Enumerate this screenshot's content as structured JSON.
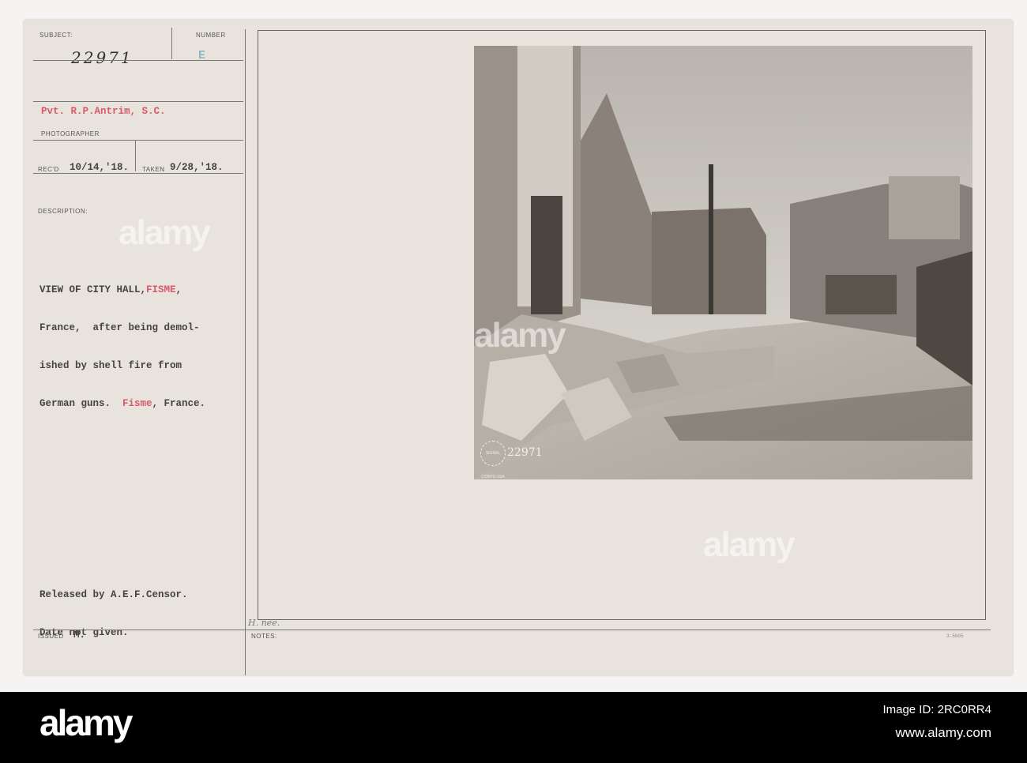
{
  "card": {
    "subject_label": "SUBJECT:",
    "subject_value": "22971",
    "number_label": "NUMBER",
    "number_value": "E",
    "photographer_value": "Pvt. R.P.Antrim, S.C.",
    "photographer_label": "PHOTOGRAPHER",
    "recd_label": "REC'D",
    "recd_value": "10/14,'18.",
    "taken_label": "TAKEN",
    "taken_value": "9/28,'18.",
    "description_label": "DESCRIPTION:",
    "description": {
      "line1_a": "VIEW OF CITY HALL,",
      "line1_red": "FISME",
      "line1_b": ",",
      "line2": "France,  after being demol-",
      "line3": "ished by shell fire from",
      "line4_a": "German guns.  ",
      "line4_red": "Fisme",
      "line4_b": ", France."
    },
    "release_line1": "Released by A.E.F.Censor.",
    "release_line2": "Date not given.",
    "issued_label": "ISSUED",
    "issued_value": "M.",
    "notes_label": "NOTES:",
    "notes_handwriting": "H. nee.",
    "form_number": "3-5605",
    "photo_stamp_number": "22971",
    "photo_stamp_text": "SIGNAL CORPS USA"
  },
  "watermark": "alamy",
  "footer": {
    "logo": "alamy",
    "image_id": "Image ID: 2RC0RR4",
    "url": "www.alamy.com"
  }
}
